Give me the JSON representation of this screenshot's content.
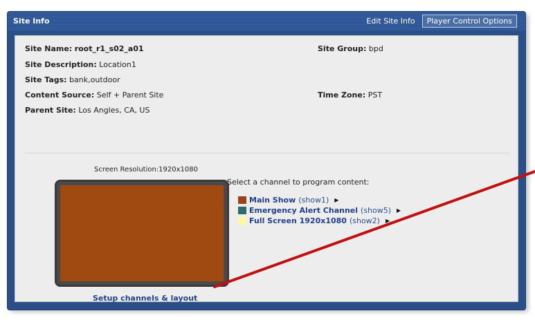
{
  "header": {
    "title": "Site Info",
    "edit_label": "Edit Site Info",
    "player_label": "Player Control Options"
  },
  "site": {
    "name_label": "Site Name:",
    "name_value": "root_r1_s02_a01",
    "group_label": "Site Group:",
    "group_value": "bpd",
    "description_label": "Site Description:",
    "description_value": "Location1",
    "tags_label": "Site Tags:",
    "tags_value": "bank,outdoor",
    "content_source_label": "Content Source:",
    "content_source_value": "Self + Parent Site",
    "timezone_label": "Time Zone:",
    "timezone_value": "PST",
    "parent_label": "Parent Site:",
    "parent_value": "Los Angles, CA, US"
  },
  "screen": {
    "resolution_label": "Screen Resolution:1920x1080",
    "color": "#a04a12",
    "setup_link": "Setup channels & layout"
  },
  "channels": {
    "prompt": "Select a channel to program content:",
    "items": [
      {
        "name": "Main Show",
        "show": "(show1)",
        "color": "#9a4218"
      },
      {
        "name": "Emergency Alert Channel",
        "show": "(show5)",
        "color": "#2f6a6a"
      },
      {
        "name": "Full Screen 1920x1080",
        "show": "(show2)",
        "color": "#fff6a8"
      }
    ]
  },
  "colors": {
    "header_bg": "#2b5190",
    "annotation_line": "#c01010"
  }
}
